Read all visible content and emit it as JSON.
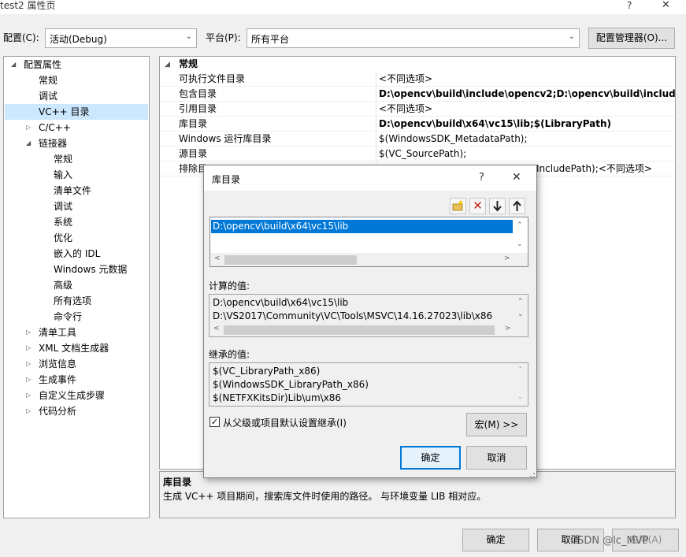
{
  "window": {
    "title": "test2 属性页",
    "help": "?",
    "close": "✕"
  },
  "toolbar": {
    "config_label": "配置(C):",
    "config_value": "活动(Debug)",
    "platform_label": "平台(P):",
    "platform_value": "所有平台",
    "config_manager": "配置管理器(O)..."
  },
  "tree": {
    "items": [
      {
        "label": "配置属性",
        "level": 0,
        "expanded": true
      },
      {
        "label": "常规",
        "level": 1
      },
      {
        "label": "调试",
        "level": 1
      },
      {
        "label": "VC++ 目录",
        "level": 1,
        "selected": true
      },
      {
        "label": "C/C++",
        "level": 1,
        "collapsed": true
      },
      {
        "label": "链接器",
        "level": 1,
        "expanded": true
      },
      {
        "label": "常规",
        "level": 2
      },
      {
        "label": "输入",
        "level": 2
      },
      {
        "label": "清单文件",
        "level": 2
      },
      {
        "label": "调试",
        "level": 2
      },
      {
        "label": "系统",
        "level": 2
      },
      {
        "label": "优化",
        "level": 2
      },
      {
        "label": "嵌入的 IDL",
        "level": 2
      },
      {
        "label": "Windows 元数据",
        "level": 2
      },
      {
        "label": "高级",
        "level": 2
      },
      {
        "label": "所有选项",
        "level": 2
      },
      {
        "label": "命令行",
        "level": 2
      },
      {
        "label": "清单工具",
        "level": 1,
        "collapsed": true
      },
      {
        "label": "XML 文档生成器",
        "level": 1,
        "collapsed": true
      },
      {
        "label": "浏览信息",
        "level": 1,
        "collapsed": true
      },
      {
        "label": "生成事件",
        "level": 1,
        "collapsed": true
      },
      {
        "label": "自定义生成步骤",
        "level": 1,
        "collapsed": true
      },
      {
        "label": "代码分析",
        "level": 1,
        "collapsed": true
      }
    ]
  },
  "grid": {
    "section": "常规",
    "rows": [
      {
        "name": "可执行文件目录",
        "value": "<不同选项>",
        "bold": false
      },
      {
        "name": "包含目录",
        "value": "D:\\opencv\\build\\include\\opencv2;D:\\opencv\\build\\include\\o",
        "bold": true
      },
      {
        "name": "引用目录",
        "value": "<不同选项>",
        "bold": false
      },
      {
        "name": "库目录",
        "value": "D:\\opencv\\build\\x64\\vc15\\lib;$(LibraryPath)",
        "bold": true
      },
      {
        "name": "Windows 运行库目录",
        "value": "$(WindowsSDK_MetadataPath);",
        "bold": false
      },
      {
        "name": "源目录",
        "value": "$(VC_SourcePath);",
        "bold": false
      },
      {
        "name": "排除目",
        "value": "IncludePath);<不同选项>",
        "bold": false
      }
    ]
  },
  "description": {
    "title": "库目录",
    "text": "生成 VC++ 项目期间，搜索库文件时使用的路径。 与环境变量 LIB 相对应。"
  },
  "dialog": {
    "title": "库目录",
    "help": "?",
    "close": "✕",
    "entries": [
      "D:\\opencv\\build\\x64\\vc15\\lib"
    ],
    "computed_label": "计算的值:",
    "computed_values": [
      "D:\\opencv\\build\\x64\\vc15\\lib",
      "D:\\VS2017\\Community\\VC\\Tools\\MSVC\\14.16.27023\\lib\\x86"
    ],
    "inherited_label": "继承的值:",
    "inherited_values": [
      "$(VC_LibraryPath_x86)",
      "$(WindowsSDK_LibraryPath_x86)",
      "$(NETFXKitsDir)Lib\\um\\x86"
    ],
    "inherit_checkbox": "从父级或项目默认设置继承(I)",
    "inherit_checked": true,
    "macro_button": "宏(M) >>",
    "ok": "确定",
    "cancel": "取消"
  },
  "footer": {
    "ok": "确定",
    "cancel": "取消",
    "apply": "应用(A)",
    "watermark": "CSDN @lc_MVP"
  }
}
